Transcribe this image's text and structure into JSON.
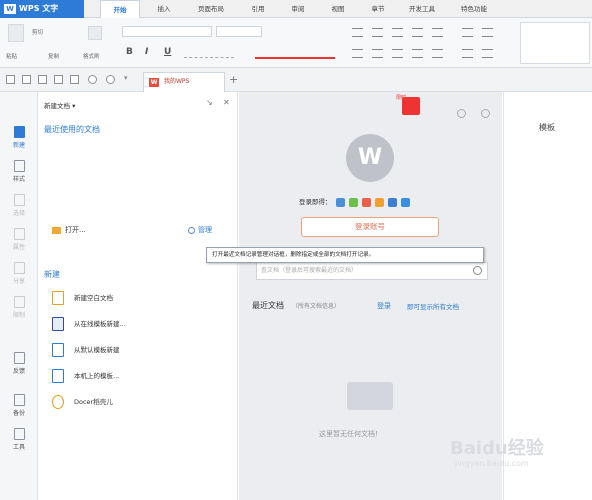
{
  "app": {
    "title": "WPS 文字"
  },
  "menu_tabs": [
    "开始",
    "插入",
    "页面布局",
    "引用",
    "审阅",
    "视图",
    "章节",
    "开发工具",
    "特色功能"
  ],
  "ribbon": {
    "paste": "粘贴",
    "cut": "剪切",
    "copy": "复制",
    "format_painter": "格式刷",
    "bold": "B",
    "italic": "I",
    "underline": "U"
  },
  "doc_tab": {
    "label": "我的WPS",
    "add": "+"
  },
  "sidebar": {
    "items": [
      "新建",
      "样式",
      "选择",
      "属性",
      "分享",
      "限制",
      "反馈",
      "备份",
      "工具"
    ]
  },
  "panel": {
    "title": "新建文档 ▾",
    "recent_heading": "最近使用的文档",
    "open_label": "打开...",
    "manage_label": "管理",
    "new_heading": "新建",
    "new_items": [
      "新建空白文档",
      "从在线模板新建...",
      "从默认模板新建",
      "本机上的模板...",
      "Docer稻壳儿"
    ]
  },
  "main": {
    "logo": "W",
    "gift_label": "限时",
    "login_prompt": "登录即得：",
    "login_button": "登录账号",
    "search_placeholder": "查文档（登录后可搜索最近的文档）",
    "recent_title": "最近文档",
    "recent_sub": "（所有文档信息）",
    "login_link": "登录",
    "show_all": "即可显示所有文档",
    "empty_text": "这里暂无任何文档!"
  },
  "template_pane": {
    "heading": "模板"
  },
  "tooltip": "打开最近文档记录管理对话框，删除指定或全部的文档打开记录。",
  "watermark": {
    "logo": "Baidu经验",
    "sub": "jingyan.baidu.com"
  },
  "colors": {
    "accent": "#2d7bd6",
    "login_border": "#e8a17a",
    "gift": "#ee3333"
  }
}
